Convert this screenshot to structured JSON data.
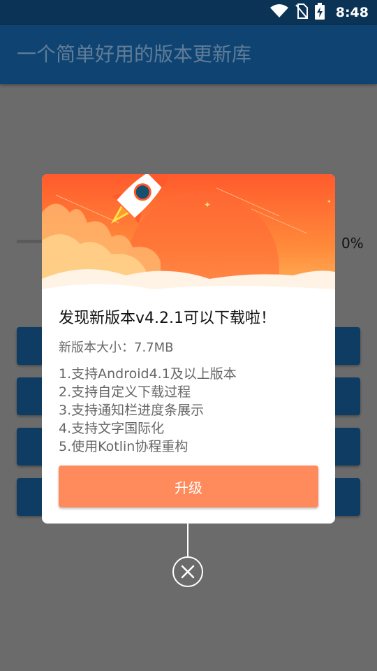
{
  "status_bar": {
    "time": "8:48"
  },
  "app_bar": {
    "title": "一个简单好用的版本更新库"
  },
  "background": {
    "progress_text": "0%"
  },
  "dialog": {
    "title": "发现新版本v4.2.1可以下载啦！",
    "size_text": "新版本大小：7.7MB",
    "changelog": [
      "1.支持Android4.1及以上版本",
      "2.支持自定义下载过程",
      "3.支持通知栏进度条展示",
      "4.支持文字国际化",
      "5.使用Kotlin协程重构"
    ],
    "upgrade_label": "升级",
    "accent_color": "#ff8a5c"
  },
  "colors": {
    "app_bar": "#0f4472",
    "status_bar": "#0b3356",
    "overlay": "#6b6b6b"
  },
  "icons": [
    "wifi-icon",
    "no-sim-icon",
    "battery-charging-icon",
    "rocket-icon",
    "close-icon"
  ]
}
